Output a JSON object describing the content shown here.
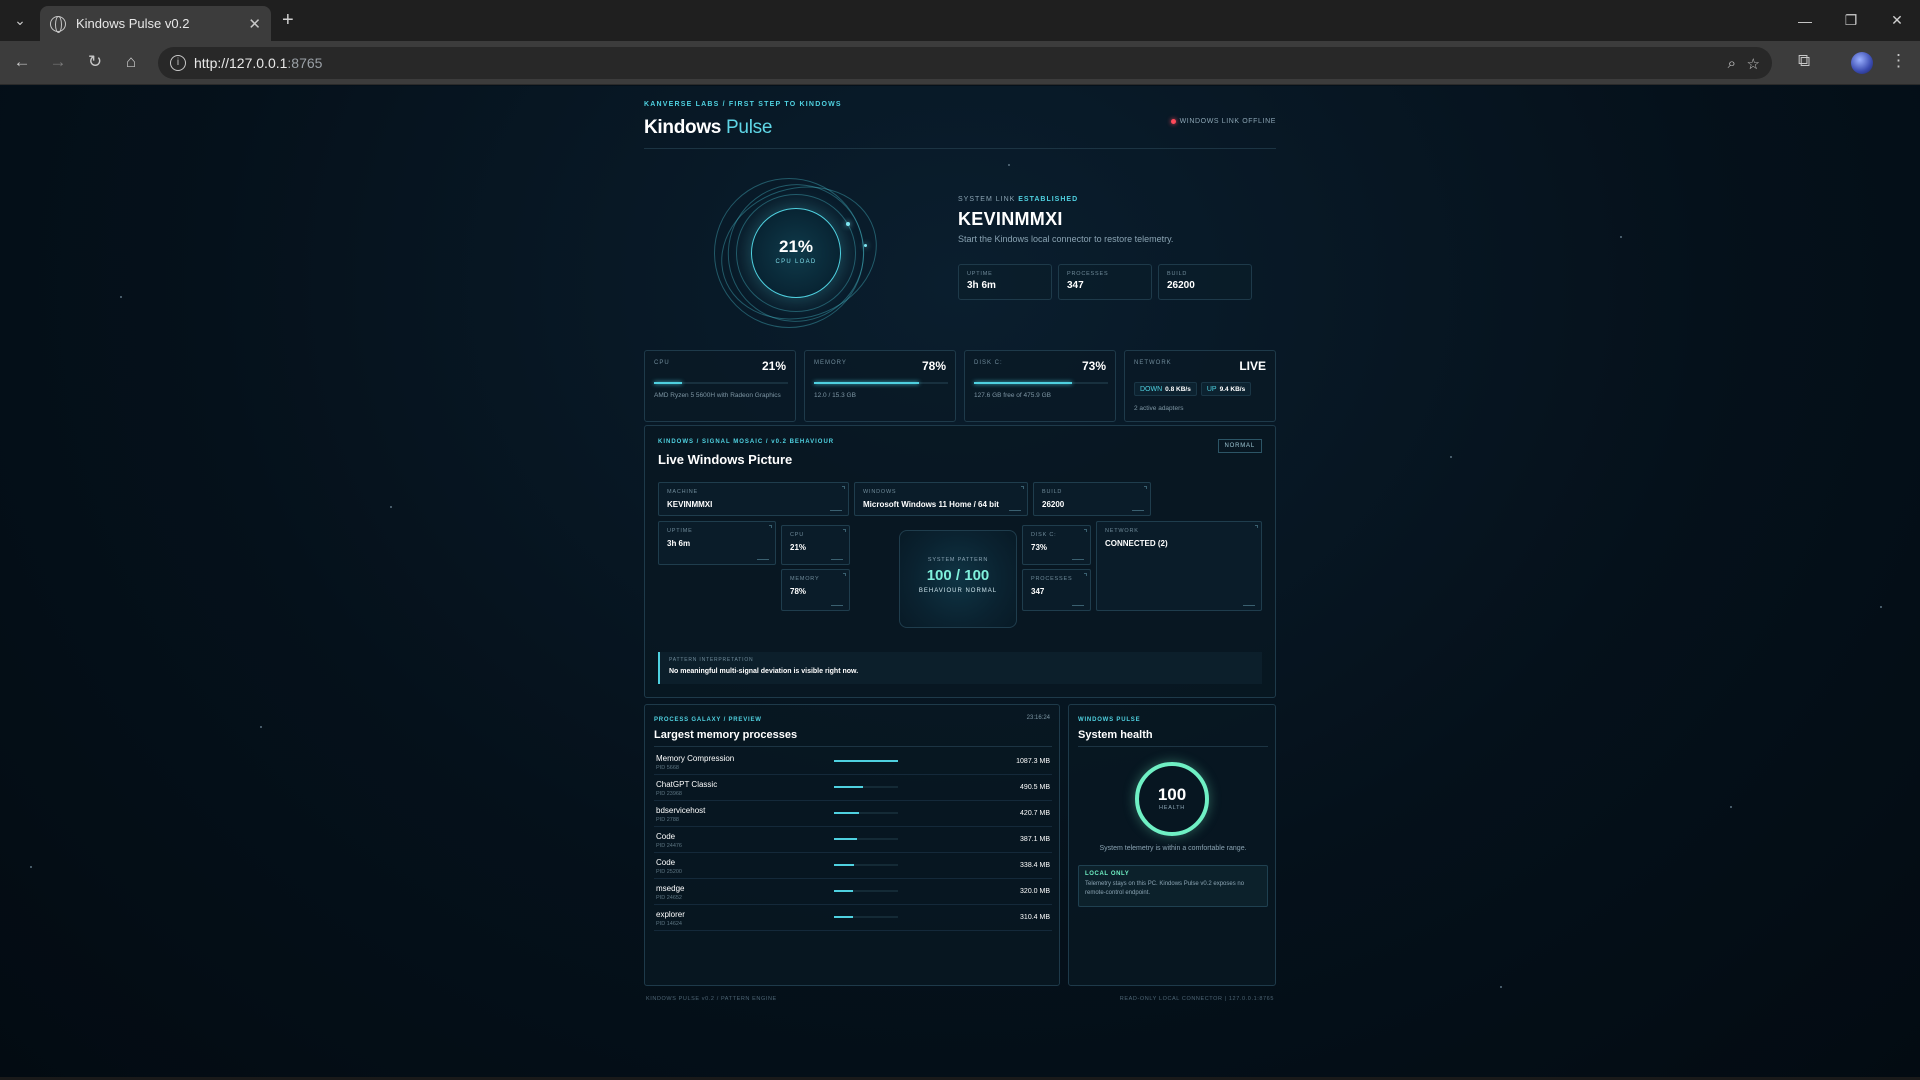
{
  "browser": {
    "tab_title": "Kindows Pulse v0.2",
    "url_host": "http://127.0.0.1",
    "url_port": ":8765",
    "tab_close": "✕",
    "new_tab": "+",
    "win_min": "—",
    "win_restore": "❐",
    "win_close": "✕",
    "tabs_menu": "⌄",
    "back": "←",
    "forward": "→",
    "reload": "↻",
    "home": "⌂",
    "zoom": "⌕",
    "bookmark": "☆",
    "extensions": "⧉",
    "menu": "⋮"
  },
  "header": {
    "kicker": "KANVERSE LABS / FIRST STEP TO KINDOWS",
    "title_main": "Kindows",
    "title_accent": " Pulse",
    "link_status": "WINDOWS LINK OFFLINE"
  },
  "hero": {
    "cpu_pct": "21%",
    "cpu_label": "CPU LOAD",
    "system_link_label": "SYSTEM LINK",
    "system_link_state": "ESTABLISHED",
    "hostname": "KEVINMMXI",
    "message": "Start the Kindows local connector to restore telemetry.",
    "stats": [
      {
        "label": "UPTIME",
        "value": "3h 6m"
      },
      {
        "label": "PROCESSES",
        "value": "347"
      },
      {
        "label": "BUILD",
        "value": "26200"
      }
    ]
  },
  "metrics": {
    "cpu": {
      "label": "CPU",
      "value": "21%",
      "fill": 0.21,
      "sub": "AMD Ryzen 5 5600H with Radeon Graphics"
    },
    "memory": {
      "label": "MEMORY",
      "value": "78%",
      "fill": 0.78,
      "sub": "12.0 / 15.3 GB"
    },
    "disk": {
      "label": "DISK C:",
      "value": "73%",
      "fill": 0.73,
      "sub": "127.6 GB free of 475.9 GB"
    },
    "network": {
      "label": "NETWORK",
      "value": "LIVE",
      "down_label": "DOWN",
      "down_value": "0.8 KB/s",
      "up_label": "UP",
      "up_value": "9.4 KB/s",
      "sub": "2 active adapters"
    }
  },
  "mosaic": {
    "kicker": "KINDOWS / SIGNAL MOSAIC / v0.2 BEHAVIOUR",
    "title": "Live Windows Picture",
    "badge": "NORMAL",
    "tiles": {
      "machine": {
        "label": "MACHINE",
        "value": "KEVINMMXI"
      },
      "windows": {
        "label": "WINDOWS",
        "value": "Microsoft Windows 11 Home / 64 bit"
      },
      "build": {
        "label": "BUILD",
        "value": "26200"
      },
      "uptime": {
        "label": "UPTIME",
        "value": "3h 6m"
      },
      "cpu": {
        "label": "CPU",
        "value": "21%"
      },
      "memory": {
        "label": "MEMORY",
        "value": "78%"
      },
      "disk": {
        "label": "DISK C:",
        "value": "73%"
      },
      "processes": {
        "label": "PROCESSES",
        "value": "347"
      },
      "network": {
        "label": "NETWORK",
        "value": "CONNECTED (2)"
      }
    },
    "center": {
      "label": "SYSTEM PATTERN",
      "value": "100 / 100",
      "sub": "BEHAVIOUR NORMAL"
    },
    "interpretation": {
      "label": "PATTERN INTERPRETATION",
      "value": "No meaningful multi-signal deviation is visible right now."
    }
  },
  "processes": {
    "kicker": "PROCESS GALAXY / PREVIEW",
    "time": "23:16:24",
    "title": "Largest memory processes",
    "rows": [
      {
        "name": "Memory Compression",
        "pid": "PID 5668",
        "mem": "1087.3 MB",
        "fill": 1.0
      },
      {
        "name": "ChatGPT Classic",
        "pid": "PID 23968",
        "mem": "490.5 MB",
        "fill": 0.45
      },
      {
        "name": "bdservicehost",
        "pid": "PID 2788",
        "mem": "420.7 MB",
        "fill": 0.39
      },
      {
        "name": "Code",
        "pid": "PID 24476",
        "mem": "387.1 MB",
        "fill": 0.36
      },
      {
        "name": "Code",
        "pid": "PID 25200",
        "mem": "338.4 MB",
        "fill": 0.31
      },
      {
        "name": "msedge",
        "pid": "PID 24652",
        "mem": "320.0 MB",
        "fill": 0.29
      },
      {
        "name": "explorer",
        "pid": "PID 14624",
        "mem": "310.4 MB",
        "fill": 0.29
      }
    ]
  },
  "health": {
    "kicker": "WINDOWS PULSE",
    "title": "System health",
    "score": "100",
    "score_label": "HEALTH",
    "message": "System telemetry is within a comfortable range.",
    "local_title": "LOCAL ONLY",
    "local_text": "Telemetry stays on this PC. Kindows Pulse v0.2 exposes no remote-control endpoint."
  },
  "footer": {
    "left": "KINDOWS PULSE v0.2 / PATTERN ENGINE",
    "right": "READ-ONLY LOCAL CONNECTOR | 127.0.0.1:8765"
  },
  "colors": {
    "accent": "#4fd1e0",
    "health": "#6ff0c4",
    "offline": "#ff4a5a",
    "background": "#04101a"
  }
}
